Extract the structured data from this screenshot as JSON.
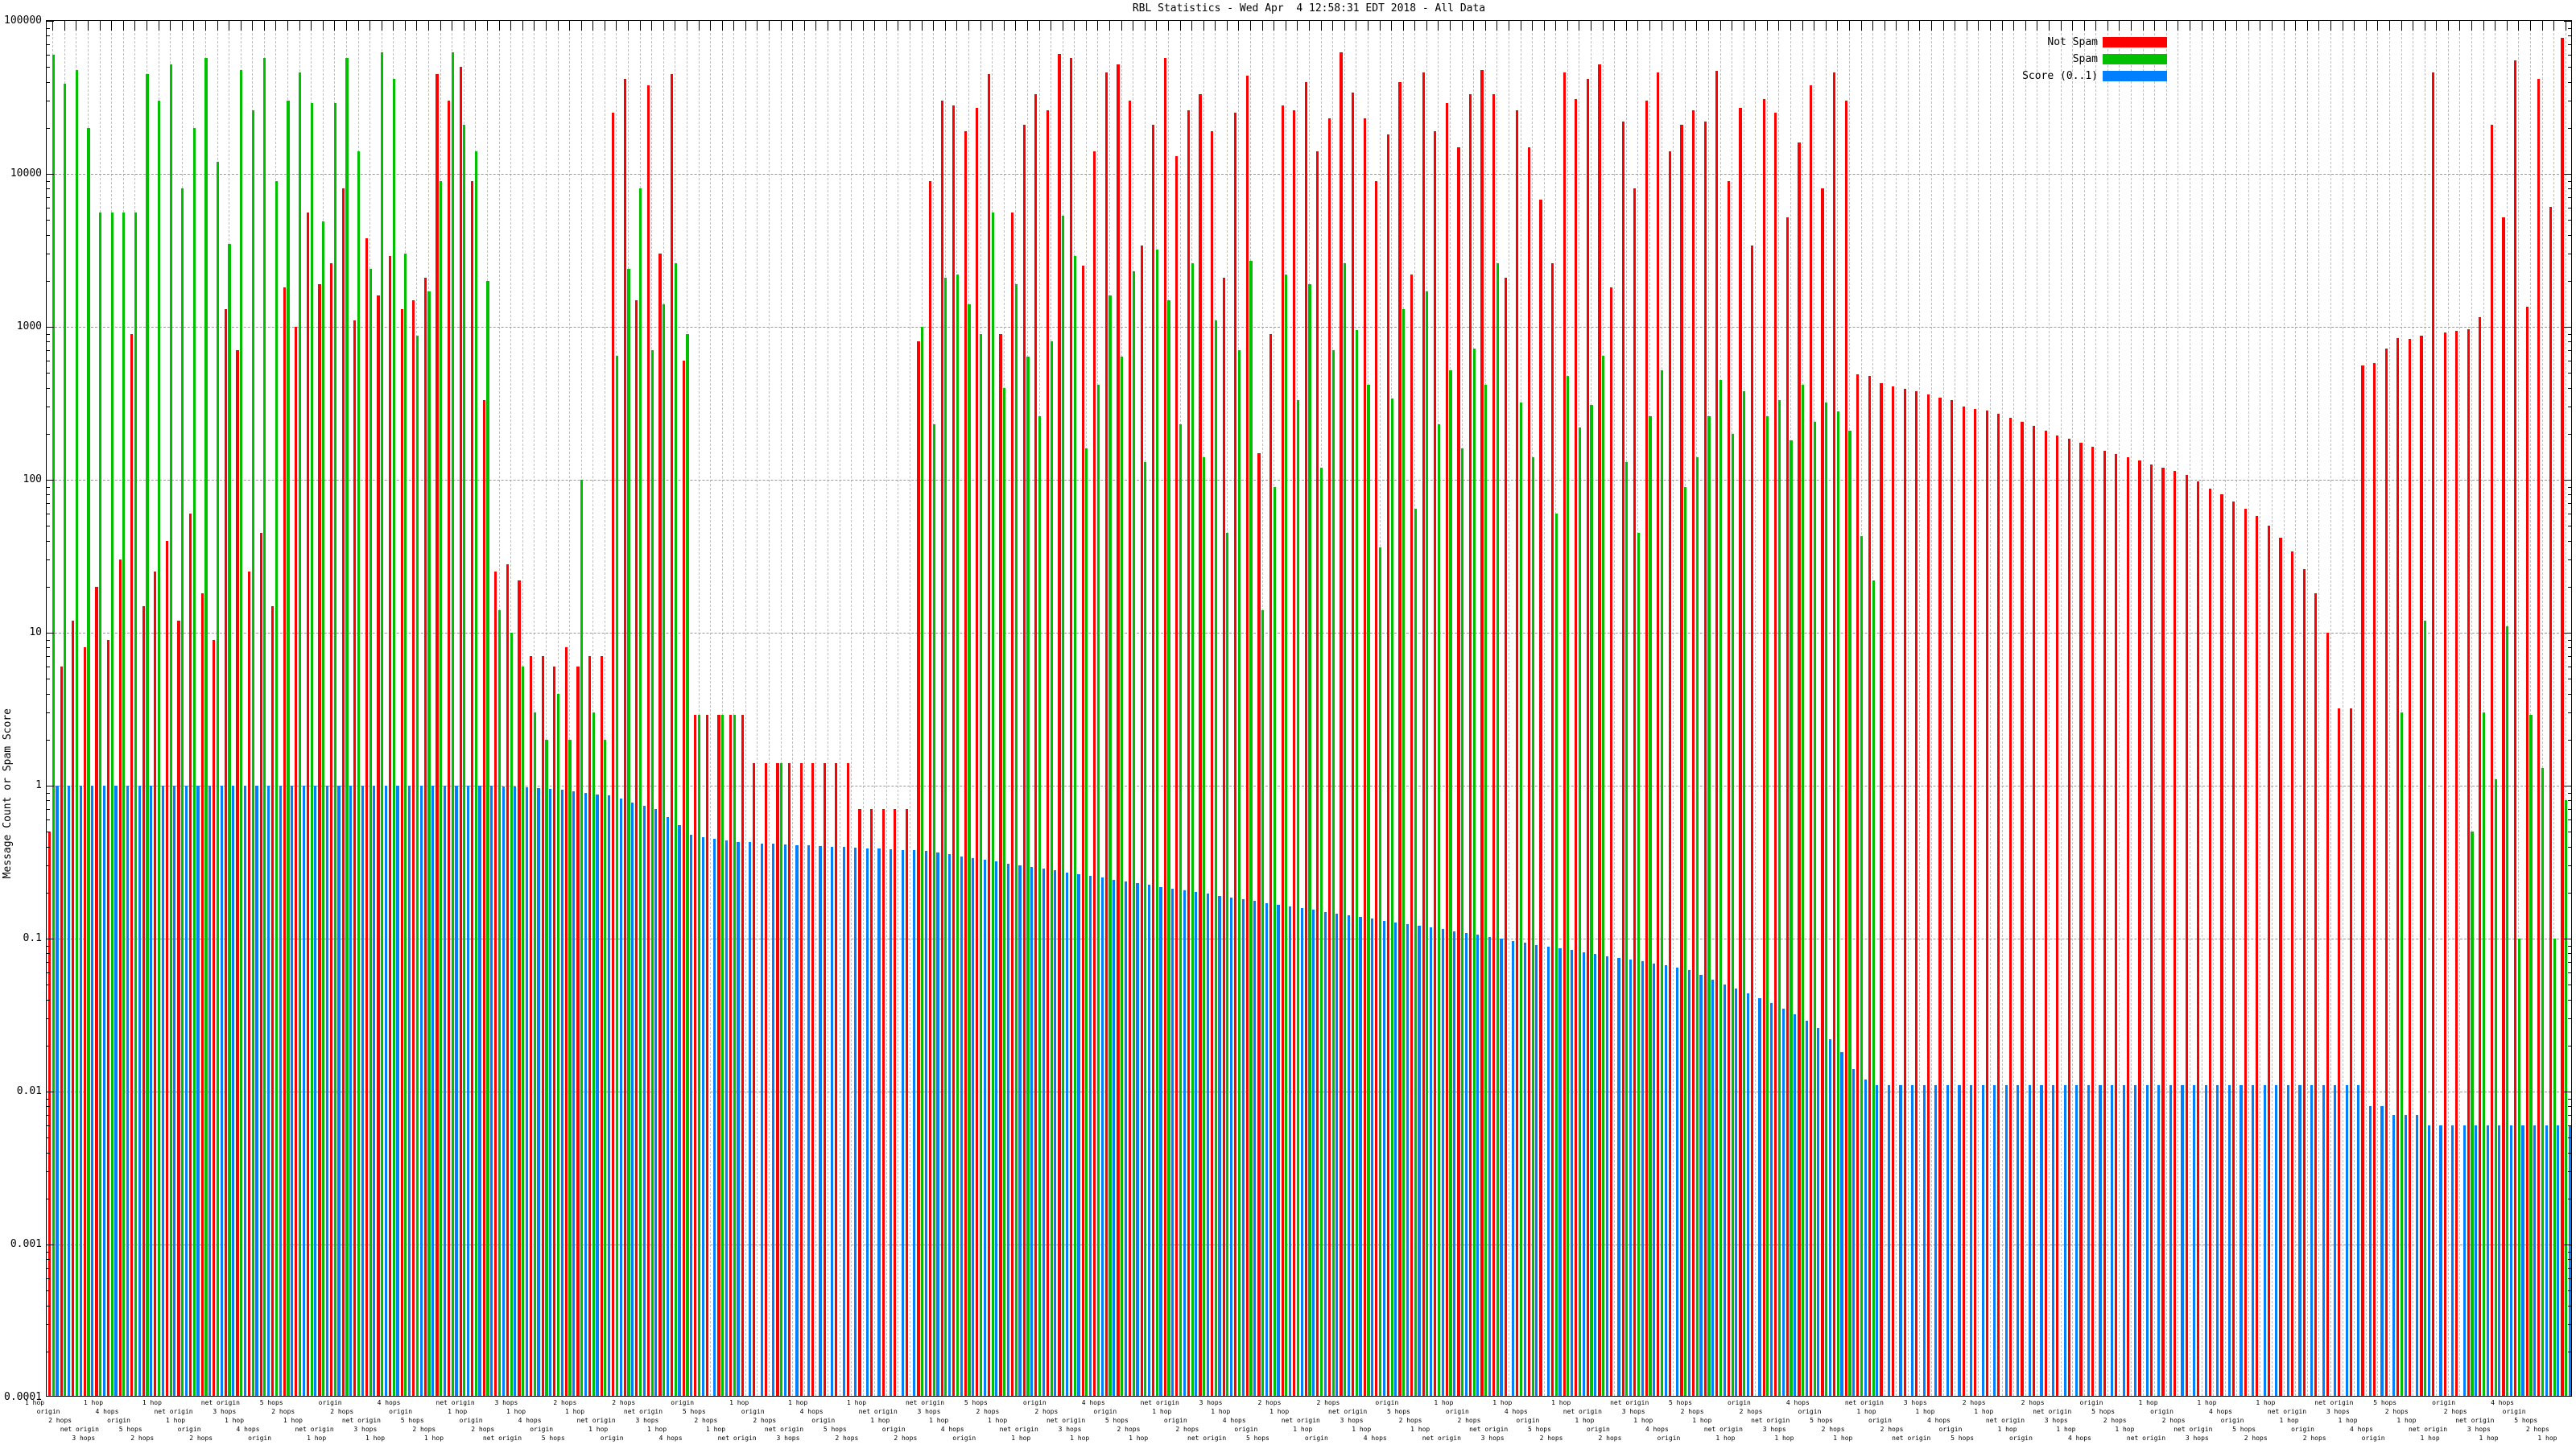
{
  "title": "RBL Statistics - Wed Apr  4 12:58:31 EDT 2018 - All Data",
  "y_axis": {
    "label": "Message Count or Spam Score",
    "tick_labels": [
      "100000",
      "10000",
      "1000",
      "100",
      "10",
      "1",
      "0.1",
      "0.01",
      "0.001",
      "0.0001"
    ]
  },
  "x_axis": {
    "tick_labels_legible": false,
    "readable_fragments": [
      "1 hop",
      "origin",
      "2 hops",
      "net origin",
      "3 hops",
      "1 hop",
      "4 hops",
      "origin",
      "5 hops",
      "2 hops",
      "1 hop",
      "net origin"
    ]
  },
  "legend": {
    "items": [
      {
        "label": "Not Spam",
        "color": "#ff0000"
      },
      {
        "label": "Spam",
        "color": "#00c000"
      },
      {
        "label": "Score (0..1)",
        "color": "#0080ff"
      }
    ]
  },
  "chart_data": {
    "type": "bar",
    "scale": "log",
    "ylim": [
      0.0001,
      100000
    ],
    "grid": true,
    "legend_position": "top-right",
    "title": "RBL Statistics - Wed Apr  4 12:58:31 EDT 2018 - All Data",
    "ylabel": "Message Count or Spam Score",
    "n_groups": 215,
    "series": [
      {
        "name": "Not Spam",
        "color": "#ff0000",
        "values": [
          0.5,
          6,
          12,
          8,
          20,
          9,
          30,
          900,
          15,
          25,
          40,
          12,
          60,
          18,
          9,
          1300,
          700,
          25,
          45,
          15,
          1800,
          1000,
          5600,
          1900,
          2600,
          8000,
          1100,
          3800,
          1600,
          2900,
          1300,
          1500,
          2100,
          45000,
          30000,
          50000,
          9000,
          330,
          25,
          28,
          22,
          7,
          7,
          6,
          8,
          6,
          7,
          7,
          25000,
          42000,
          1500,
          38000,
          3000,
          45000,
          600,
          2.9,
          2.9,
          2.9,
          2.9,
          2.9,
          1.4,
          1.4,
          1.4,
          1.4,
          1.4,
          1.4,
          1.4,
          1.4,
          1.4,
          0.7,
          0.7,
          0.7,
          0.7,
          0.7,
          800,
          9000,
          30000,
          28000,
          19000,
          27000,
          45000,
          900,
          5600,
          21000,
          33000,
          26000,
          61000,
          57000,
          2500,
          14000,
          46000,
          52000,
          30000,
          3400,
          21000,
          57000,
          13000,
          26000,
          33000,
          19000,
          2100,
          25000,
          44000,
          150,
          900,
          28000,
          26000,
          40000,
          14000,
          23000,
          62000,
          34000,
          23000,
          9000,
          18000,
          40000,
          2200,
          46000,
          19000,
          29000,
          15000,
          33000,
          48000,
          33000,
          2100,
          26000,
          15000,
          6800,
          2600,
          46000,
          31000,
          42000,
          52000,
          1800,
          22000,
          8000,
          30000,
          46000,
          14000,
          21000,
          26000,
          22000,
          47000,
          9000,
          27000,
          3400,
          31000,
          25000,
          5200,
          16000,
          38000,
          8000,
          46000,
          30000,
          490,
          480,
          430,
          410,
          395,
          380,
          360,
          345,
          330,
          300,
          290,
          285,
          270,
          255,
          240,
          225,
          210,
          195,
          185,
          175,
          165,
          155,
          148,
          140,
          133,
          126,
          120,
          114,
          108,
          98,
          88,
          80,
          72,
          65,
          58,
          50,
          42,
          34,
          26,
          18,
          10,
          3.2,
          3.2,
          560,
          580,
          720,
          840,
          830,
          880,
          46000,
          920,
          940,
          960,
          1150,
          21000,
          5200,
          55000,
          1350,
          42000,
          6100,
          78000
        ]
      },
      {
        "name": "Spam",
        "color": "#00c000",
        "values": [
          60000,
          39000,
          48000,
          20000,
          5600,
          5600,
          5600,
          5600,
          45000,
          30000,
          52000,
          8000,
          20000,
          57000,
          12000,
          3500,
          48000,
          26000,
          57000,
          9000,
          30000,
          46000,
          29000,
          4900,
          29000,
          57000,
          14000,
          2400,
          62000,
          42000,
          3000,
          880,
          1700,
          9000,
          62000,
          21000,
          14000,
          2000,
          14,
          10,
          6,
          3,
          2,
          4,
          2,
          100,
          3,
          2,
          650,
          2400,
          8000,
          700,
          1400,
          2600,
          900,
          2.9,
          null,
          2.9,
          2.9,
          null,
          null,
          null,
          1.4,
          null,
          null,
          null,
          null,
          null,
          null,
          null,
          null,
          null,
          null,
          null,
          1000,
          230,
          2100,
          2200,
          1400,
          900,
          5600,
          400,
          1900,
          640,
          260,
          800,
          5300,
          2900,
          160,
          420,
          1600,
          640,
          2300,
          130,
          3200,
          1500,
          230,
          2600,
          140,
          1100,
          45,
          700,
          2700,
          14,
          90,
          2200,
          330,
          1900,
          120,
          700,
          2600,
          950,
          420,
          36,
          340,
          1300,
          65,
          1700,
          230,
          520,
          160,
          720,
          420,
          2600,
          null,
          320,
          140,
          null,
          60,
          480,
          220,
          310,
          650,
          null,
          130,
          45,
          260,
          520,
          null,
          90,
          140,
          260,
          450,
          200,
          380,
          null,
          260,
          330,
          180,
          420,
          240,
          320,
          280,
          210,
          43,
          22,
          null,
          null,
          null,
          null,
          null,
          null,
          null,
          null,
          null,
          null,
          null,
          null,
          null,
          null,
          null,
          null,
          null,
          null,
          null,
          null,
          null,
          null,
          null,
          null,
          null,
          null,
          null,
          null,
          null,
          null,
          null,
          null,
          null,
          null,
          null,
          null,
          null,
          null,
          null,
          null,
          null,
          null,
          null,
          null,
          3,
          null,
          12,
          null,
          null,
          null,
          0.5,
          3,
          1.1,
          11,
          0.1,
          2.9,
          1.3,
          0.1,
          0.8
        ]
      },
      {
        "name": "Score (0..1)",
        "color": "#0080ff",
        "values": [
          1,
          1,
          1,
          1,
          1,
          1,
          1,
          1,
          1,
          1,
          1,
          1,
          1,
          1,
          1,
          1,
          1,
          1,
          1,
          1,
          1,
          1,
          1,
          1,
          1,
          1,
          1,
          1,
          1,
          1,
          1,
          1,
          1,
          1,
          1,
          1,
          1,
          1,
          0.99,
          0.985,
          0.98,
          0.97,
          0.955,
          0.94,
          0.92,
          0.9,
          0.88,
          0.86,
          0.82,
          0.78,
          0.74,
          0.7,
          0.62,
          0.55,
          0.48,
          0.46,
          0.45,
          0.44,
          0.43,
          0.43,
          0.42,
          0.42,
          0.415,
          0.41,
          0.41,
          0.405,
          0.4,
          0.4,
          0.395,
          0.39,
          0.39,
          0.385,
          0.38,
          0.38,
          0.375,
          0.365,
          0.355,
          0.346,
          0.337,
          0.328,
          0.319,
          0.31,
          0.302,
          0.294,
          0.286,
          0.279,
          0.271,
          0.264,
          0.257,
          0.25,
          0.243,
          0.237,
          0.231,
          0.224,
          0.218,
          0.213,
          0.207,
          0.201,
          0.196,
          0.191,
          0.186,
          0.181,
          0.176,
          0.171,
          0.167,
          0.162,
          0.158,
          0.154,
          0.15,
          0.146,
          0.142,
          0.138,
          0.135,
          0.131,
          0.128,
          0.124,
          0.121,
          0.118,
          0.115,
          0.112,
          0.109,
          0.106,
          0.103,
          0.1,
          0.097,
          0.094,
          0.091,
          0.089,
          0.086,
          0.084,
          0.081,
          0.079,
          0.077,
          0.075,
          0.073,
          0.071,
          0.069,
          0.067,
          0.065,
          0.062,
          0.058,
          0.054,
          0.05,
          0.047,
          0.044,
          0.041,
          0.038,
          0.035,
          0.032,
          0.029,
          0.026,
          0.022,
          0.018,
          0.014,
          0.012,
          0.011,
          0.011,
          0.011,
          0.011,
          0.011,
          0.011,
          0.011,
          0.011,
          0.011,
          0.011,
          0.011,
          0.011,
          0.011,
          0.011,
          0.011,
          0.011,
          0.011,
          0.011,
          0.011,
          0.011,
          0.011,
          0.011,
          0.011,
          0.011,
          0.011,
          0.011,
          0.011,
          0.011,
          0.011,
          0.011,
          0.011,
          0.011,
          0.011,
          0.011,
          0.011,
          0.011,
          0.011,
          0.011,
          0.011,
          0.011,
          0.011,
          0.011,
          0.008,
          0.008,
          0.007,
          0.007,
          0.007,
          0.006,
          0.006,
          0.006,
          0.006,
          0.006,
          0.006,
          0.006,
          0.006,
          0.006,
          0.006,
          0.006,
          0.006,
          0.006
        ]
      }
    ]
  }
}
